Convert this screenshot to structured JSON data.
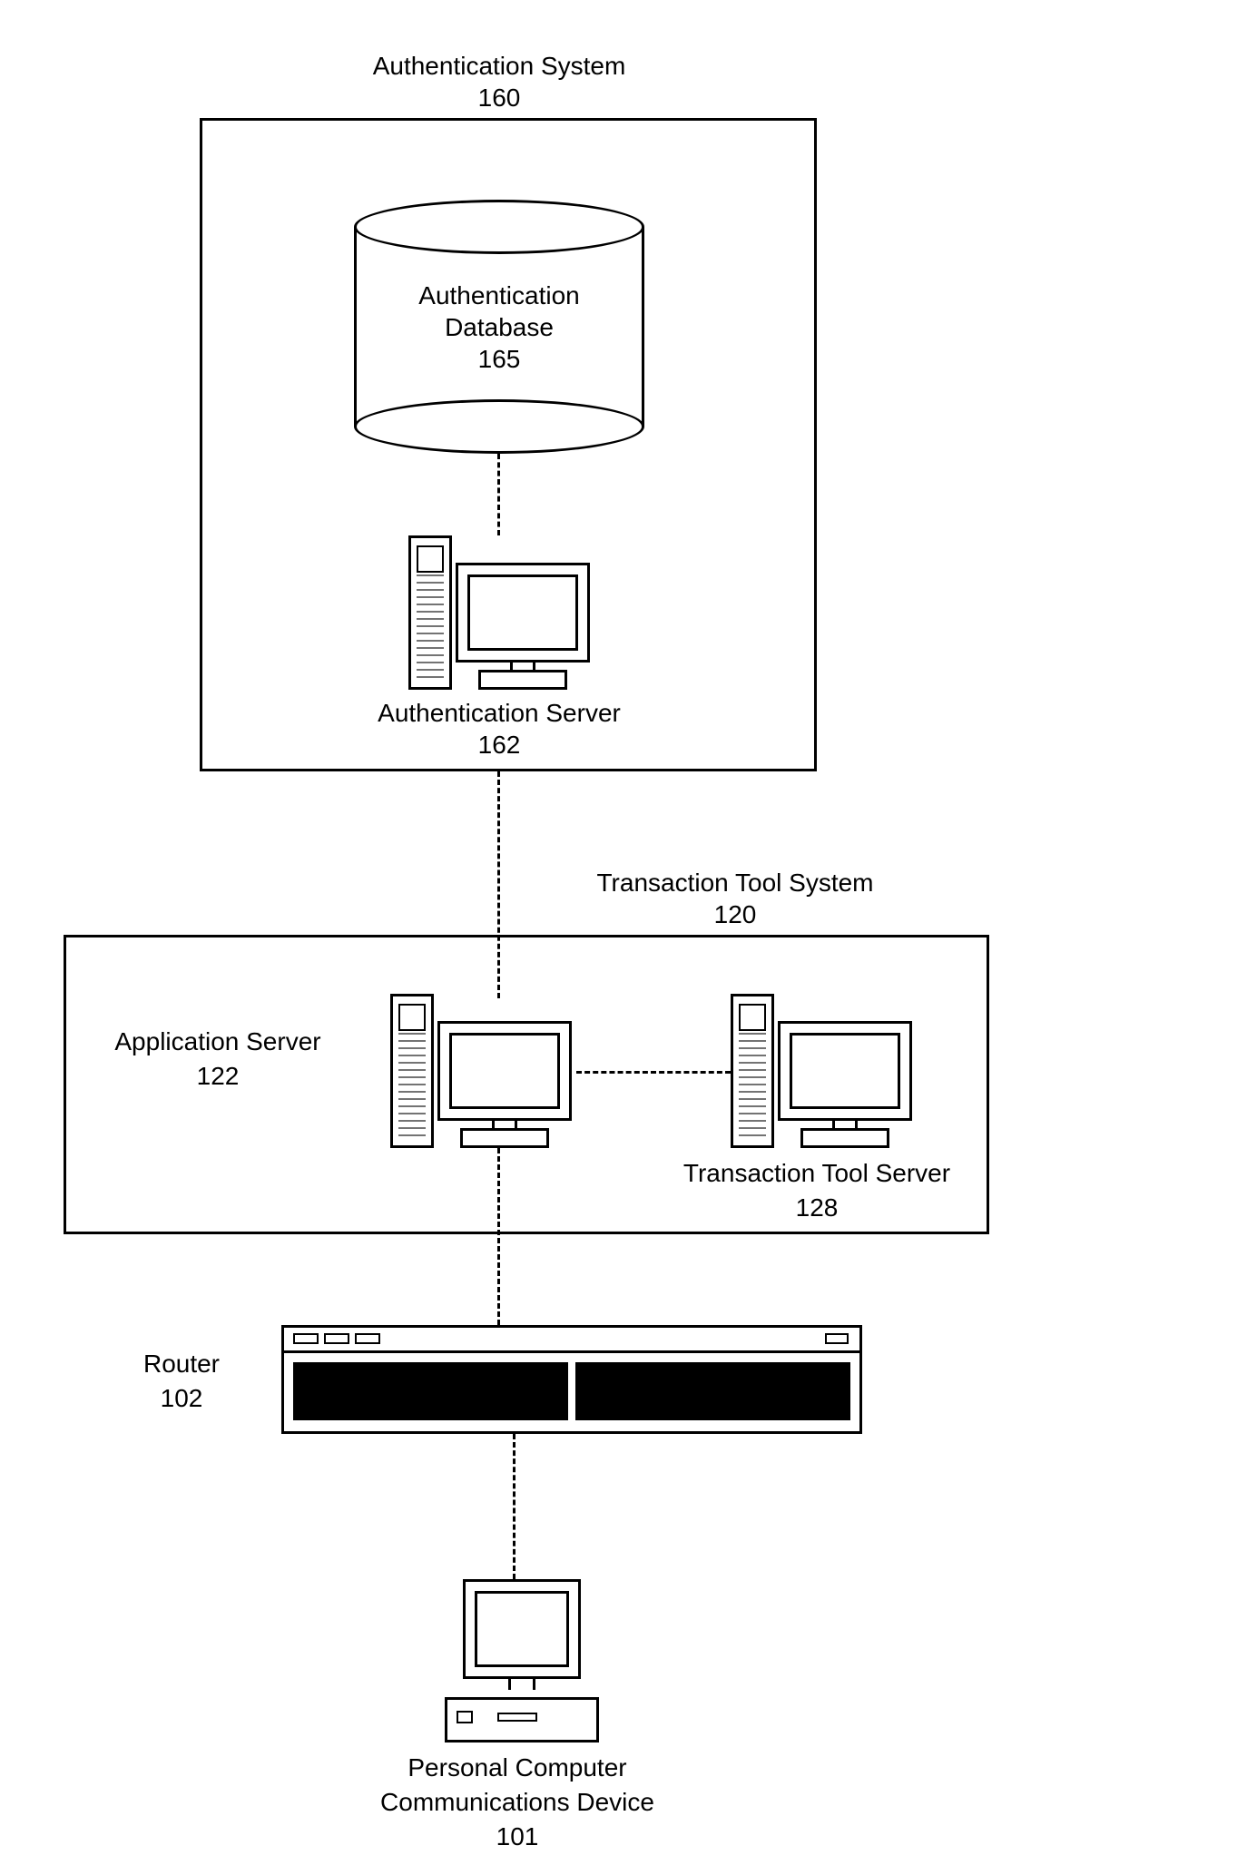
{
  "auth_system": {
    "title": "Authentication System",
    "ref": "160",
    "database": {
      "label": "Authentication",
      "label2": "Database",
      "ref": "165"
    },
    "server": {
      "label": "Authentication Server",
      "ref": "162"
    }
  },
  "tts": {
    "title": "Transaction Tool System",
    "ref": "120",
    "app_server": {
      "label": "Application Server",
      "ref": "122"
    },
    "tt_server": {
      "label": "Transaction Tool  Server",
      "ref": "128"
    }
  },
  "router": {
    "label": "Router",
    "ref": "102"
  },
  "pc": {
    "label1": "Personal Computer",
    "label2": "Communications Device",
    "ref": "101"
  }
}
